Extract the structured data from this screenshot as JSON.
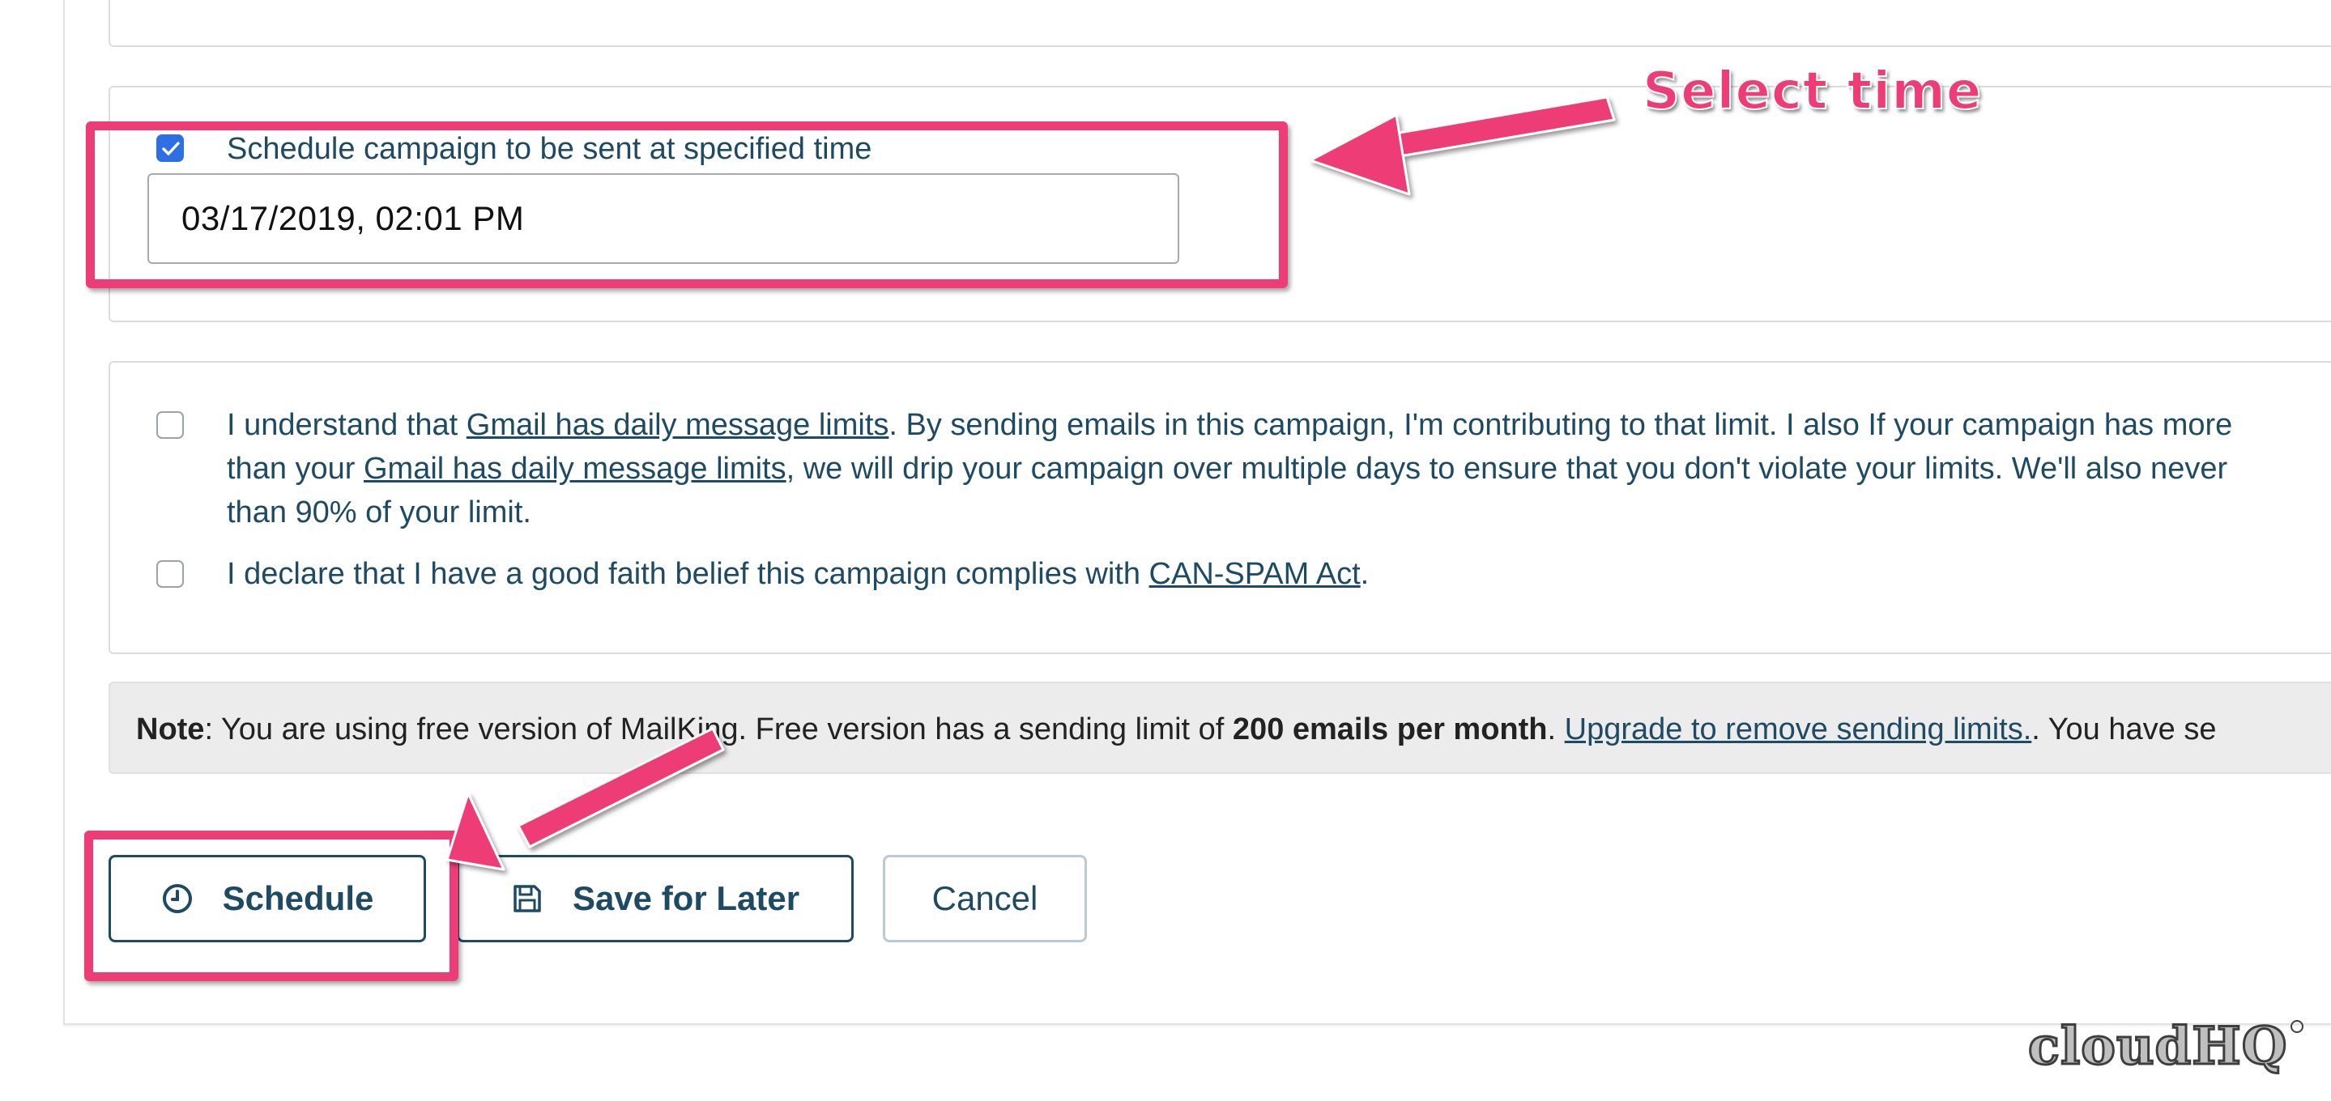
{
  "schedule": {
    "checkbox_label": "Schedule campaign to be sent at specified time",
    "checked": true,
    "datetime_value": "03/17/2019, 02:01 PM"
  },
  "terms": {
    "line1_prefix": "I understand that ",
    "gmail_limits_link": "Gmail has daily message limits",
    "line1_suffix": ". By sending emails in this campaign, I'm contributing to that limit. I also If your campaign has more",
    "line2_prefix": "than your ",
    "line2_suffix": ", we will drip your campaign over multiple days to ensure that you don't violate your limits. We'll also never",
    "line3": "than 90% of your limit.",
    "declare_prefix": "I declare that I have a good faith belief this campaign complies with ",
    "canspam_link": "CAN-SPAM Act",
    "declare_suffix": "."
  },
  "note": {
    "label": "Note",
    "text_part1": ": You are using free version of MailKing. Free version has a sending limit of ",
    "limit_bold": "200 emails per month",
    "text_part2": ". ",
    "upgrade_link": "Upgrade to remove sending limits.",
    "text_part3": ". You have se"
  },
  "buttons": {
    "schedule_label": "Schedule",
    "save_label": "Save for Later",
    "cancel_label": "Cancel"
  },
  "annotation": {
    "label": "Select time",
    "color": "#ee3d76"
  },
  "watermark": "cloudHQ",
  "colors": {
    "text": "#1e4a63",
    "checkbox_checked": "#2f6fe4",
    "note_bg": "#ececec"
  },
  "icons": {
    "schedule": "clock-icon",
    "save": "floppy-disk-icon"
  }
}
